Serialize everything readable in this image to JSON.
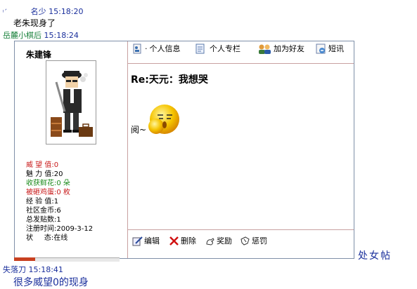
{
  "chat": {
    "line1": {
      "icon": "small-link-icon",
      "user": "名少",
      "time": "15:18:20",
      "message": "老朱现身了"
    },
    "line2": {
      "user": "岳麓小棋后",
      "time": "15:18:24"
    },
    "line3": {
      "user": "失落刀",
      "time": "15:18:41",
      "message": "很多威望0的现身"
    }
  },
  "author": {
    "name": "朱建锋",
    "stats": {
      "prestige": "威 望 值:0",
      "charm": "魅 力 值:20",
      "flowers": "收获鲜花:0 朵",
      "eggs": "被砸鸡蛋:0 枚",
      "experience": "经 验 值:1",
      "gold": "社区金币:6",
      "posts": "总发贴数:1",
      "registered": "注册时间:2009-3-12",
      "status": "状     态:在线"
    }
  },
  "toolbar": {
    "profile": "个人信息",
    "column": "个人专栏",
    "add_friend": "加为好友",
    "message": "短讯"
  },
  "post": {
    "title": "Re:天元：我想哭",
    "body": "阅~"
  },
  "footer": {
    "edit": "编辑",
    "delete": "删除",
    "reward": "奖励",
    "punish": "惩罚"
  },
  "stamp": "处女帖",
  "colors": {
    "link_blue": "#1a2f9c",
    "green": "#17803a",
    "red": "#c81818"
  }
}
